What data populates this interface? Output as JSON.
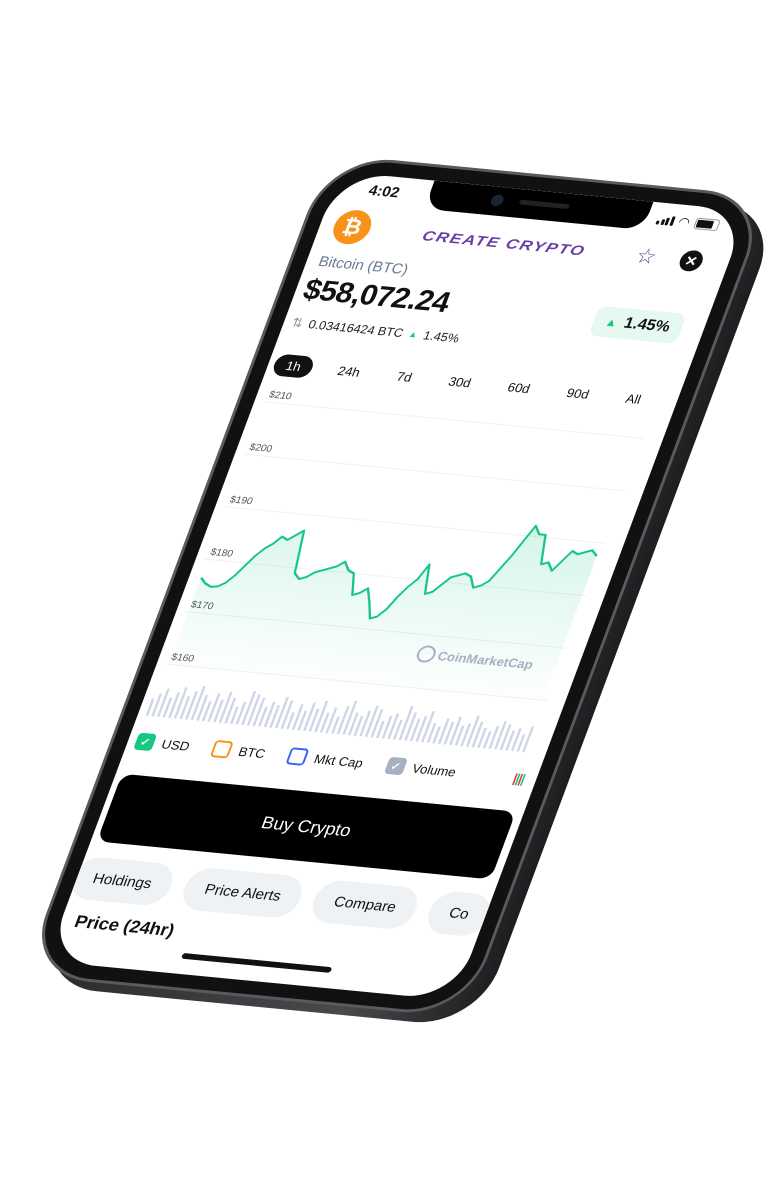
{
  "status_bar": {
    "time": "4:02"
  },
  "header": {
    "brand": "CREATE CRYPTO",
    "coin_icon": "bitcoin-icon",
    "coin_symbol": "₿",
    "star_icon": "☆",
    "close_icon": "✕"
  },
  "coin": {
    "name": "Bitcoin (BTC)",
    "price": "$58,072.24",
    "btc_amount": "0.03416424 BTC",
    "change": "1.45%",
    "change_badge": "1.45%",
    "change_color": "#16c784"
  },
  "time_tabs": [
    {
      "label": "1h",
      "active": true
    },
    {
      "label": "24h"
    },
    {
      "label": "7d"
    },
    {
      "label": "30d"
    },
    {
      "label": "60d"
    },
    {
      "label": "90d"
    },
    {
      "label": "All"
    }
  ],
  "chart_data": {
    "type": "area",
    "y_ticks": [
      "$210",
      "$200",
      "$190",
      "$180",
      "$170",
      "$160"
    ],
    "ylim": [
      160,
      210
    ],
    "grid": true,
    "line_color": "#16c784",
    "watermark": "CoinMarketCap",
    "values": [
      176.5,
      175.5,
      175,
      175.2,
      176,
      177.5,
      179.5,
      181.5,
      183,
      184,
      185.5,
      185,
      186,
      187,
      179,
      178,
      178.5,
      179.5,
      180,
      180.5,
      181,
      182,
      180.5,
      180,
      176,
      176.5,
      177.5,
      175,
      172,
      172.5,
      174,
      176.5,
      178.5,
      180,
      183,
      177.5,
      178,
      179.5,
      181,
      181.5,
      182,
      181.5,
      179.5,
      180,
      181,
      183.5,
      186,
      189,
      192,
      190.5,
      190.5,
      185,
      185.5,
      184,
      186,
      188,
      187.5,
      188,
      188.5,
      187.5
    ],
    "volume": [
      6,
      8,
      10,
      7,
      9,
      11,
      8,
      10,
      12,
      9,
      7,
      10,
      8,
      11,
      9,
      6,
      8,
      12,
      11,
      10,
      7,
      9,
      8,
      11,
      10,
      6,
      9,
      7,
      10,
      8,
      11,
      7,
      9,
      6,
      10,
      12,
      8,
      7,
      9,
      11,
      10,
      6,
      8,
      9,
      7,
      12,
      10,
      8,
      9,
      11,
      7,
      6,
      9,
      8,
      10,
      7,
      8,
      11,
      9,
      7,
      6,
      8,
      10,
      9,
      7,
      8,
      6,
      9
    ],
    "volume_color": "#cdd5e6"
  },
  "legend": [
    {
      "label": "USD",
      "checked": true,
      "color": "#16c784"
    },
    {
      "label": "BTC",
      "checked": false,
      "color": "#f7931a"
    },
    {
      "label": "Mkt Cap",
      "checked": false,
      "color": "#3861fb"
    },
    {
      "label": "Volume",
      "checked": true,
      "color": "#a6b0c3"
    }
  ],
  "candle_icon": "candlestick-icon",
  "buy_button": "Buy Crypto",
  "chips": [
    "Holdings",
    "Price Alerts",
    "Compare",
    "Co"
  ],
  "section_heading": "Price (24hr)"
}
